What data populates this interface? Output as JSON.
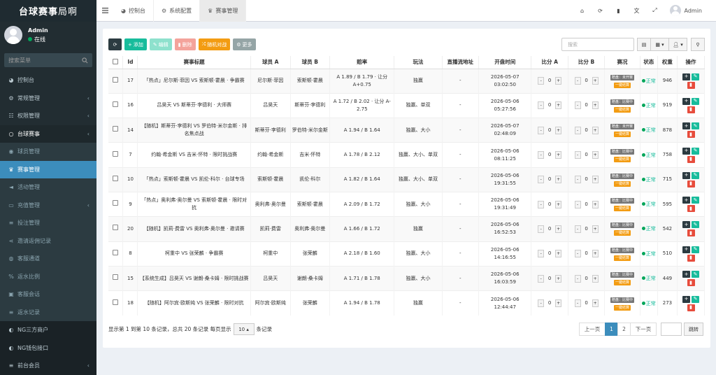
{
  "app": {
    "logo_bold": "台球赛事",
    "logo_thin": "局啊"
  },
  "user": {
    "name": "Admin",
    "status": "在线"
  },
  "sidebar": {
    "search_placeholder": "搜索菜单",
    "items": [
      {
        "label": "控制台",
        "icon": "dashboard-icon",
        "style": "normal",
        "chev": false
      },
      {
        "label": "常规管理",
        "icon": "cog-icon",
        "style": "normal",
        "chev": true
      },
      {
        "label": "权限管理",
        "icon": "group-icon",
        "style": "normal",
        "chev": true
      },
      {
        "label": "台球赛事",
        "icon": "circle-icon",
        "style": "open",
        "chev": true
      },
      {
        "label": "球员管理",
        "icon": "user-circle-icon",
        "style": "sub",
        "chev": false
      },
      {
        "label": "赛事管理",
        "icon": "trophy-icon",
        "style": "active",
        "chev": false
      },
      {
        "label": "活动管理",
        "icon": "bullhorn-icon",
        "style": "sub",
        "chev": false
      },
      {
        "label": "充值管理",
        "icon": "money-icon",
        "style": "sub",
        "chev": true
      },
      {
        "label": "投注管理",
        "icon": "list-icon",
        "style": "sub",
        "chev": false
      },
      {
        "label": "邀请返佣记录",
        "icon": "share-icon",
        "style": "sub",
        "chev": false
      },
      {
        "label": "客服通道",
        "icon": "headset-icon",
        "style": "sub",
        "chev": false
      },
      {
        "label": "返水比例",
        "icon": "percent-icon",
        "style": "sub",
        "chev": false
      },
      {
        "label": "客服会话",
        "icon": "chat-icon",
        "style": "sub",
        "chev": false
      },
      {
        "label": "返水记录",
        "icon": "list-icon",
        "style": "sub",
        "chev": false
      },
      {
        "label": "NG三方商户",
        "icon": "toggle-icon",
        "style": "dark",
        "chev": false
      },
      {
        "label": "NG钱包接口",
        "icon": "toggle-icon",
        "style": "dark",
        "chev": false
      },
      {
        "label": "前台会员",
        "icon": "list-icon",
        "style": "dark",
        "chev": true
      }
    ]
  },
  "header": {
    "tabs": [
      {
        "label": "控制台",
        "icon": "dashboard-icon",
        "active": false
      },
      {
        "label": "系统配置",
        "icon": "cog-icon",
        "active": false
      },
      {
        "label": "赛事管理",
        "icon": "trophy-icon",
        "active": true
      }
    ],
    "right_icons": [
      "home-icon",
      "refresh-icon",
      "trash-icon",
      "translate-icon",
      "fullscreen-icon"
    ],
    "username": "Admin"
  },
  "toolbar": {
    "add": "添加",
    "edit": "编辑",
    "delete": "删除",
    "random": "随机对战",
    "more": "更多",
    "search_placeholder": "搜索"
  },
  "table": {
    "headers": [
      "Id",
      "赛事标题",
      "球员 A",
      "球员 B",
      "赔率",
      "玩法",
      "直播流地址",
      "开盘时间",
      "比分 A",
      "比分 B",
      "赛况",
      "状态",
      "权重",
      "操作"
    ],
    "rows": [
      {
        "id": "17",
        "title": "「热点」尼尔斯·菲因 VS 索斯顿·霍晨 · 争霸赛",
        "a": "尼尔斯·菲因",
        "b": "索斯顿·霍晨",
        "odds": "A 1.89 / B 1.79 · 让分 A+0.75",
        "play": "独赢",
        "stream": "-",
        "date": "2026-05-07",
        "time": "03:02:50",
        "sa": "0",
        "sb": "0",
        "badge": "赔盘：未开赛",
        "status": "正常",
        "weight": "946"
      },
      {
        "id": "16",
        "title": "吕昊天 VS 斯蒂芬·李德利 · 大师赛",
        "a": "吕昊天",
        "b": "斯蒂芬·李德利",
        "odds": "A 1.72 / B 2.02 · 让分 A-2.75",
        "play": "独赢、单双",
        "stream": "-",
        "date": "2026-05-06",
        "time": "05:27:56",
        "sa": "0",
        "sb": "0",
        "badge": "赔盘：比赛中",
        "status": "正常",
        "weight": "919"
      },
      {
        "id": "14",
        "title": "【随机】斯蒂芬·李德利 VS 罗伯特·米尔金斯 · 排名焦点战",
        "a": "斯蒂芬·李德利",
        "b": "罗伯特·米尔金斯",
        "odds": "A 1.94 / B 1.64",
        "play": "独赢、大小",
        "stream": "-",
        "date": "2026-05-07",
        "time": "02:48:09",
        "sa": "0",
        "sb": "0",
        "badge": "赔盘：未开赛",
        "status": "正常",
        "weight": "878"
      },
      {
        "id": "7",
        "title": "约翰·希金斯 VS 吉米·怀特 · 限时挑战赛",
        "a": "约翰·希金斯",
        "b": "吉米·怀特",
        "odds": "A 1.78 / B 2.12",
        "play": "独赢、大小、单双",
        "stream": "-",
        "date": "2026-05-06",
        "time": "08:11:25",
        "sa": "0",
        "sb": "0",
        "badge": "赔盘：比赛中",
        "status": "正常",
        "weight": "758"
      },
      {
        "id": "10",
        "title": "「热点」索斯顿·霍晨 VS 凯伦·科尔 · 台球专场",
        "a": "索斯顿·霍晨",
        "b": "凯伦·科尔",
        "odds": "A 1.82 / B 1.64",
        "play": "独赢、大小、单双",
        "stream": "-",
        "date": "2026-05-06",
        "time": "19:31:55",
        "sa": "0",
        "sb": "0",
        "badge": "赔盘：比赛中",
        "status": "正常",
        "weight": "715"
      },
      {
        "id": "9",
        "title": "「热点」奥利弗·奥尔曼 VS 索斯顿·霍晨 · 限时对抗",
        "a": "奥利弗·奥尔曼",
        "b": "索斯顿·霍晨",
        "odds": "A 2.09 / B 1.72",
        "play": "独赢、大小",
        "stream": "-",
        "date": "2026-05-06",
        "time": "19:31:49",
        "sa": "0",
        "sb": "0",
        "badge": "赔盘：比赛中",
        "status": "正常",
        "weight": "595"
      },
      {
        "id": "20",
        "title": "【随机】凯莉·费雷 VS 奥利弗·奥尔曼 · 邀请赛",
        "a": "凯莉·费雷",
        "b": "奥利弗·奥尔曼",
        "odds": "A 1.66 / B 1.72",
        "play": "独赢",
        "stream": "-",
        "date": "2026-05-06",
        "time": "16:52:53",
        "sa": "0",
        "sb": "0",
        "badge": "赔盘：比赛中",
        "status": "正常",
        "weight": "542"
      },
      {
        "id": "8",
        "title": "柯重中 VS 张荣麟 · 争霸赛",
        "a": "柯重中",
        "b": "张荣麟",
        "odds": "A 2.18 / B 1.60",
        "play": "独赢、大小",
        "stream": "-",
        "date": "2026-05-06",
        "time": "14:16:55",
        "sa": "0",
        "sb": "0",
        "badge": "赔盘：比赛中",
        "status": "正常",
        "weight": "510"
      },
      {
        "id": "15",
        "title": "【系统生成】吕昊天 VS 谢朗·桑卡姆 · 限时挑战赛",
        "a": "吕昊天",
        "b": "谢朗·桑卡姆",
        "odds": "A 1.71 / B 1.78",
        "play": "独赢、大小",
        "stream": "-",
        "date": "2026-05-06",
        "time": "16:03:59",
        "sa": "0",
        "sb": "0",
        "badge": "赔盘：比赛中",
        "status": "正常",
        "weight": "449"
      },
      {
        "id": "18",
        "title": "【随机】阿尔宾·欧斯纯 VS 张荣麟 · 限时对抗",
        "a": "阿尔宾·欧斯纯",
        "b": "张荣麟",
        "odds": "A 1.94 / B 1.78",
        "play": "独赢",
        "stream": "-",
        "date": "2026-05-06",
        "time": "12:44:47",
        "sa": "0",
        "sb": "0",
        "badge": "赔盘：比赛中",
        "status": "正常",
        "weight": "273"
      }
    ],
    "settle_label": "一键结算"
  },
  "pagination": {
    "info_prefix": "显示第 1 到第 10 条记录，总共 20 条记录 每页显示",
    "per_page": "10",
    "info_suffix": "条记录",
    "prev": "上一页",
    "pages": [
      "1",
      "2"
    ],
    "next": "下一页",
    "go": "跳转"
  }
}
